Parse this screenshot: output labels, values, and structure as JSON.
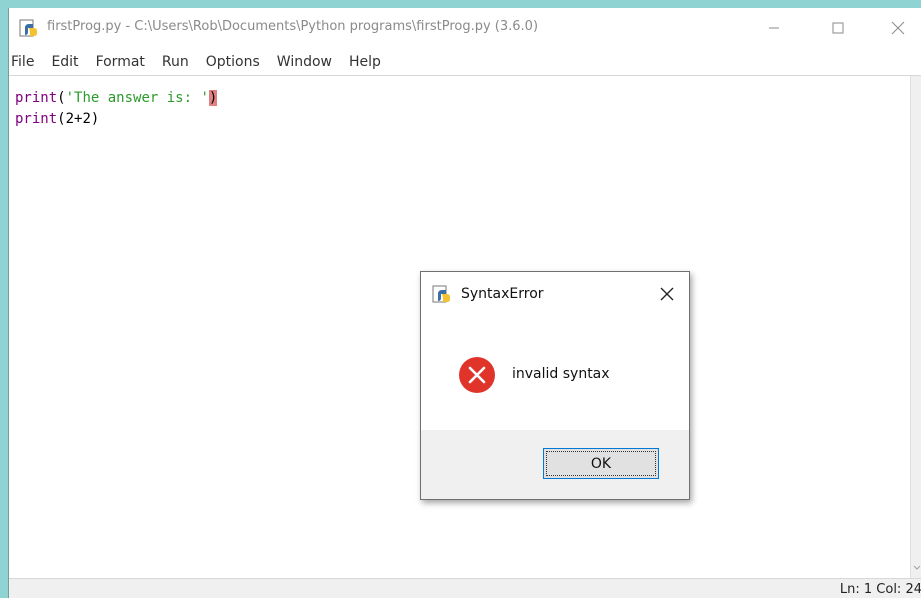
{
  "window": {
    "title": "firstProg.py - C:\\Users\\Rob\\Documents\\Python programs\\firstProg.py (3.6.0)",
    "icons": {
      "app": "python-file-icon",
      "minimize": "minimize-icon",
      "maximize": "maximize-icon",
      "close": "close-icon"
    }
  },
  "menu": {
    "items": [
      "File",
      "Edit",
      "Format",
      "Run",
      "Options",
      "Window",
      "Help"
    ]
  },
  "editor": {
    "line1": {
      "fn": "print",
      "open": "(",
      "str": "'The answer is: '",
      "close": ")"
    },
    "line2": {
      "fn": "print",
      "rest": "(2+2)"
    }
  },
  "status": {
    "position": "Ln: 1   Col: 24"
  },
  "dialog": {
    "title": "SyntaxError",
    "message": "invalid syntax",
    "ok_label": "OK",
    "icons": {
      "title": "python-icon",
      "error": "error-icon",
      "close": "close-icon"
    }
  },
  "colors": {
    "desktop": "#8fd3d3",
    "builtin": "#800080",
    "string": "#2b9b2b",
    "highlight": "#e08080",
    "error_red": "#e0342b",
    "focus_blue": "#0078d7"
  }
}
